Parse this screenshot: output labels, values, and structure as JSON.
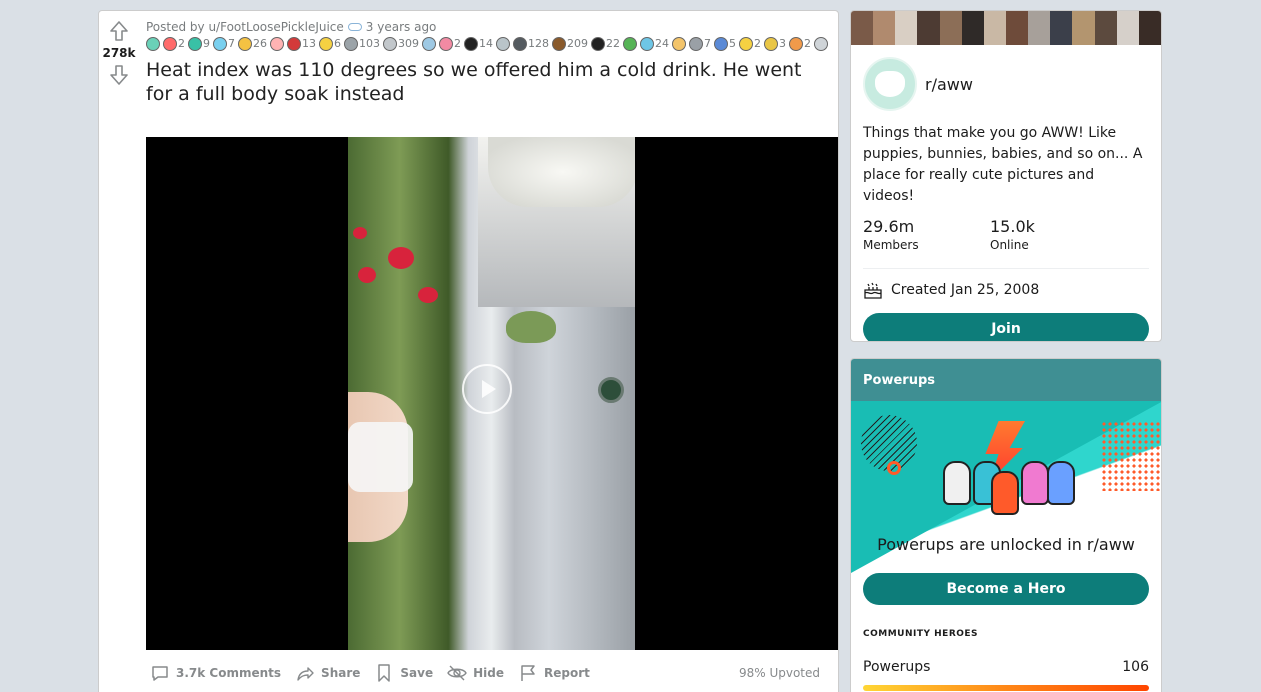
{
  "post": {
    "score": "278k",
    "posted_by": "Posted by u/FootLoosePickleJuice",
    "age": "3 years ago",
    "title": "Heat index was 110 degrees so we offered him a cold drink. He went for a full body soak instead",
    "awards": [
      {
        "icon": "award-icon",
        "count": "",
        "color": "#6ad1b8"
      },
      {
        "icon": "award-icon",
        "count": "2",
        "color": "#ff6b6b"
      },
      {
        "icon": "award-icon",
        "count": "9",
        "color": "#39c1a6"
      },
      {
        "icon": "award-icon",
        "count": "7",
        "color": "#79d0ef"
      },
      {
        "icon": "award-icon",
        "count": "26",
        "color": "#f5c242"
      },
      {
        "icon": "award-icon",
        "count": "",
        "color": "#ffb3b3"
      },
      {
        "icon": "award-icon",
        "count": "13",
        "color": "#d33a3a"
      },
      {
        "icon": "award-icon",
        "count": "6",
        "color": "#f5d142"
      },
      {
        "icon": "award-icon",
        "count": "103",
        "color": "#9ba3a8"
      },
      {
        "icon": "award-icon",
        "count": "309",
        "color": "#c2c7cb"
      },
      {
        "icon": "award-icon",
        "count": "",
        "color": "#9ec9e4"
      },
      {
        "icon": "award-icon",
        "count": "2",
        "color": "#f28aa3"
      },
      {
        "icon": "award-icon",
        "count": "14",
        "color": "#222222"
      },
      {
        "icon": "award-icon",
        "count": "",
        "color": "#b9c4c9"
      },
      {
        "icon": "award-icon",
        "count": "128",
        "color": "#555b60"
      },
      {
        "icon": "award-icon",
        "count": "209",
        "color": "#8a5a2b"
      },
      {
        "icon": "award-icon",
        "count": "22",
        "color": "#222222"
      },
      {
        "icon": "award-icon",
        "count": "",
        "color": "#56b456"
      },
      {
        "icon": "award-icon",
        "count": "24",
        "color": "#6ec6e6"
      },
      {
        "icon": "award-icon",
        "count": "",
        "color": "#f3c46a"
      },
      {
        "icon": "award-icon",
        "count": "7",
        "color": "#9aa0a6"
      },
      {
        "icon": "award-icon",
        "count": "5",
        "color": "#5b8ad6"
      },
      {
        "icon": "award-icon",
        "count": "2",
        "color": "#f5d142"
      },
      {
        "icon": "award-icon",
        "count": "3",
        "color": "#e9c646"
      },
      {
        "icon": "award-icon",
        "count": "2",
        "color": "#f19a4a"
      },
      {
        "icon": "award-icon",
        "count": "",
        "color": "#cfd4d8"
      }
    ],
    "actions": {
      "comments": "3.7k Comments",
      "share": "Share",
      "save": "Save",
      "hide": "Hide",
      "report": "Report",
      "upvoted": "98% Upvoted"
    }
  },
  "community": {
    "name": "r/aww",
    "description": "Things that make you go AWW! Like puppies, bunnies, babies, and so on... A place for really cute pictures and videos!",
    "members_value": "29.6m",
    "members_label": "Members",
    "online_value": "15.0k",
    "online_label": "Online",
    "created": "Created Jan 25, 2008",
    "join_label": "Join",
    "accent": "#0d7d7a"
  },
  "powerups": {
    "header": "Powerups",
    "unlocked_text": "Powerups are unlocked in r/aww",
    "hero_button": "Become a Hero",
    "heroes_label": "COMMUNITY HEROES",
    "row_label": "Powerups",
    "row_value": "106"
  }
}
